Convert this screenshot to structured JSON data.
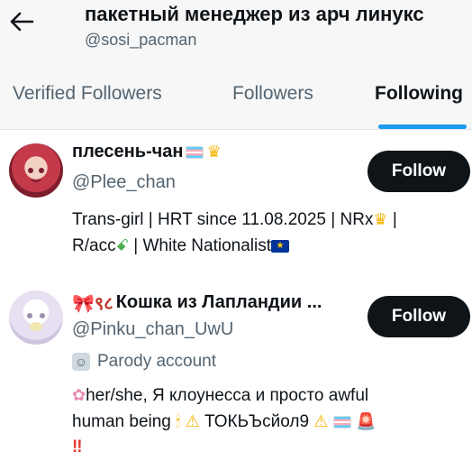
{
  "header": {
    "back_icon": "arrow-left-icon",
    "title": "пакетный менеджер из арч линукс",
    "handle": "@sosi_pacman"
  },
  "tabs": [
    {
      "label": "Verified Followers",
      "active": false
    },
    {
      "label": "Followers",
      "active": false
    },
    {
      "label": "Following",
      "active": true
    }
  ],
  "users": [
    {
      "name": "плесень-чан",
      "handle": "@Plee_chan",
      "follow_label": "Follow",
      "bio_line1_text": "Trans-girl | HRT since 11.08.2025 | NRx",
      "bio_line1_tail": " |",
      "bio_line2_prefix": "R/acc",
      "bio_line2_mid": " | White Nationalist",
      "name_badges": [
        "trans-flag-icon",
        "crown-icon"
      ]
    },
    {
      "name": "Кошка из Лапландии ...",
      "name_prefix": "🎀९८",
      "handle": "@Pinku_chan_UwU",
      "follow_label": "Follow",
      "parody_label": "Parody account",
      "bio_line1": "her/she, Я клоунесса и просто awful",
      "bio_line2_text": "human being",
      "bio_line2_mid": "ТОКЬЪсйол9",
      "bio_line3": "‼"
    }
  ],
  "colors": {
    "accent": "#1d9bf0",
    "text": "#0f1419",
    "muted": "#536471",
    "button_bg": "#0f1419"
  }
}
